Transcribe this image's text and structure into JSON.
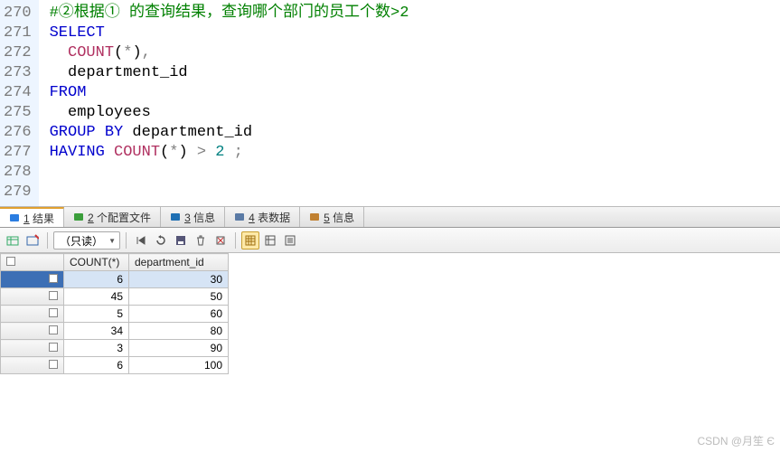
{
  "code": {
    "lines": [
      {
        "n": "270",
        "t": "comment",
        "text": "#②根据① 的查询结果，查询哪个部门的员工个数>2"
      },
      {
        "n": "271",
        "t": "kw",
        "text": "SELECT"
      },
      {
        "n": "272",
        "t": "cnt",
        "fn": "COUNT",
        "arg": "*",
        "trail": ","
      },
      {
        "n": "273",
        "t": "plain",
        "text": "  department_id"
      },
      {
        "n": "274",
        "t": "kw",
        "text": "FROM"
      },
      {
        "n": "275",
        "t": "plain",
        "text": "  employees"
      },
      {
        "n": "276",
        "t": "grp",
        "kw1": "GROUP",
        "kw2": "BY",
        "col": "department_id"
      },
      {
        "n": "277",
        "t": "hav",
        "kw": "HAVING",
        "fn": "COUNT",
        "arg": "*",
        "op": ">",
        "num": "2"
      },
      {
        "n": "278",
        "t": "empty"
      },
      {
        "n": "279",
        "t": "empty"
      }
    ]
  },
  "tabs": [
    {
      "key": "1",
      "label": "结果",
      "active": true,
      "icon": "#2a7de1"
    },
    {
      "key": "2",
      "label": "个配置文件",
      "active": false,
      "icon": "#3b9e3b"
    },
    {
      "key": "3",
      "label": "信息",
      "active": false,
      "icon": "#1f6fb3"
    },
    {
      "key": "4",
      "label": "表数据",
      "active": false,
      "icon": "#5a7aa5"
    },
    {
      "key": "5",
      "label": "信息",
      "active": false,
      "icon": "#c08030"
    }
  ],
  "toolbar": {
    "mode": "（只读）"
  },
  "grid": {
    "columns": [
      "COUNT(*)",
      "department_id"
    ],
    "rows": [
      {
        "c": "6",
        "d": "30",
        "sel": true
      },
      {
        "c": "45",
        "d": "50"
      },
      {
        "c": "5",
        "d": "60"
      },
      {
        "c": "34",
        "d": "80"
      },
      {
        "c": "3",
        "d": "90"
      },
      {
        "c": "6",
        "d": "100"
      }
    ]
  },
  "watermark": "CSDN @月笙 Є"
}
